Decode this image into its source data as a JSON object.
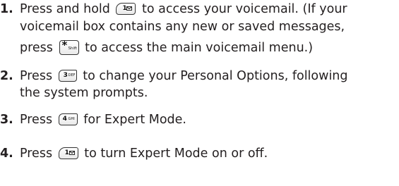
{
  "steps": [
    {
      "number": "1.",
      "lines": [
        {
          "before": "Press and hold",
          "key": "1",
          "after": "to access your voicemail. (If your"
        },
        {
          "text": "voicemail box contains any new or saved messages,"
        },
        {
          "before": "press",
          "key": "*",
          "key_sub": "Shift",
          "after": "to access the main voicemail menu.)"
        }
      ]
    },
    {
      "number": "2.",
      "lines": [
        {
          "before": "Press",
          "key": "3",
          "key_sub": "DEF",
          "after": "to change your Personal Options, following"
        },
        {
          "text": "the system prompts."
        }
      ]
    },
    {
      "number": "3.",
      "lines": [
        {
          "before": "Press",
          "key": "4",
          "key_sub": "GHI",
          "after": "for Expert Mode."
        }
      ]
    },
    {
      "number": "4.",
      "lines": [
        {
          "before": "Press",
          "key": "1",
          "after": "to turn Expert Mode on or off."
        }
      ]
    }
  ]
}
